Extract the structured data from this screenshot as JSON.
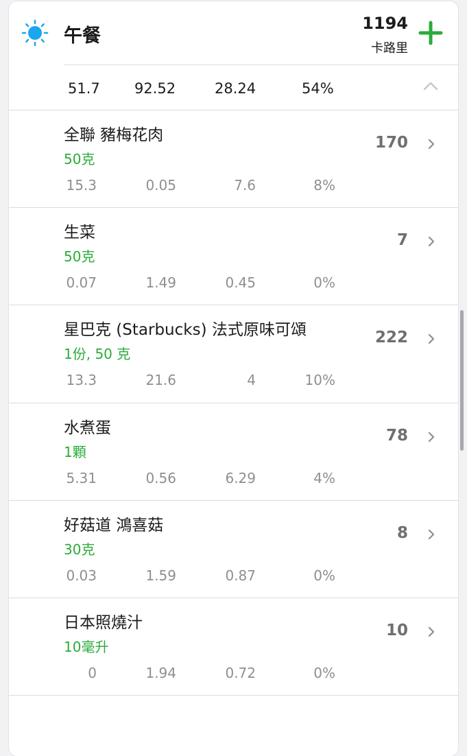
{
  "meal": {
    "title": "午餐",
    "total_calories": "1194",
    "calorie_unit": "卡路里",
    "summary": [
      "51.7",
      "92.52",
      "28.24",
      "54%"
    ]
  },
  "items": [
    {
      "name": "全聯 豬梅花肉",
      "amount": "50克",
      "nutrients": [
        "15.3",
        "0.05",
        "7.6",
        "8%"
      ],
      "calories": "170"
    },
    {
      "name": "生菜",
      "amount": "50克",
      "nutrients": [
        "0.07",
        "1.49",
        "0.45",
        "0%"
      ],
      "calories": "7"
    },
    {
      "name": "星巴克 (Starbucks) 法式原味可頌",
      "amount": "1份, 50 克",
      "nutrients": [
        "13.3",
        "21.6",
        "4",
        "10%"
      ],
      "calories": "222"
    },
    {
      "name": "水煮蛋",
      "amount": "1顆",
      "nutrients": [
        "5.31",
        "0.56",
        "6.29",
        "4%"
      ],
      "calories": "78"
    },
    {
      "name": "好菇道 鴻喜菇",
      "amount": "30克",
      "nutrients": [
        "0.03",
        "1.59",
        "0.87",
        "0%"
      ],
      "calories": "8"
    },
    {
      "name": "日本照燒汁",
      "amount": "10毫升",
      "nutrients": [
        "0",
        "1.94",
        "0.72",
        "0%"
      ],
      "calories": "10"
    }
  ],
  "colors": {
    "accent_green": "#2bab3a",
    "sun_blue": "#1aa7ef"
  },
  "icons": {
    "meal_icon": "sun-icon",
    "add": "plus-icon",
    "collapse": "chevron-up-icon",
    "row_nav": "chevron-right-icon"
  }
}
